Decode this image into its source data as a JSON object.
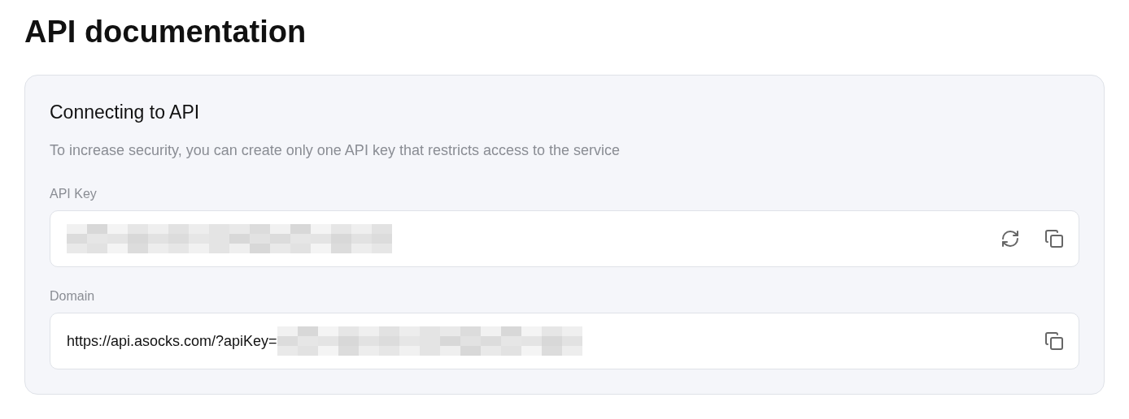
{
  "page_title": "API documentation",
  "card": {
    "title": "Connecting to API",
    "description": "To increase security, you can create only one API key that restricts access to the service",
    "fields": [
      {
        "label": "API Key",
        "redacted": true,
        "actions": [
          {
            "kind": "refresh"
          },
          {
            "kind": "copy"
          }
        ]
      },
      {
        "label": "Domain",
        "value": "https://api.asocks.com/?apiKey=",
        "redacted": true,
        "actions": [
          {
            "kind": "copy"
          }
        ]
      }
    ]
  }
}
